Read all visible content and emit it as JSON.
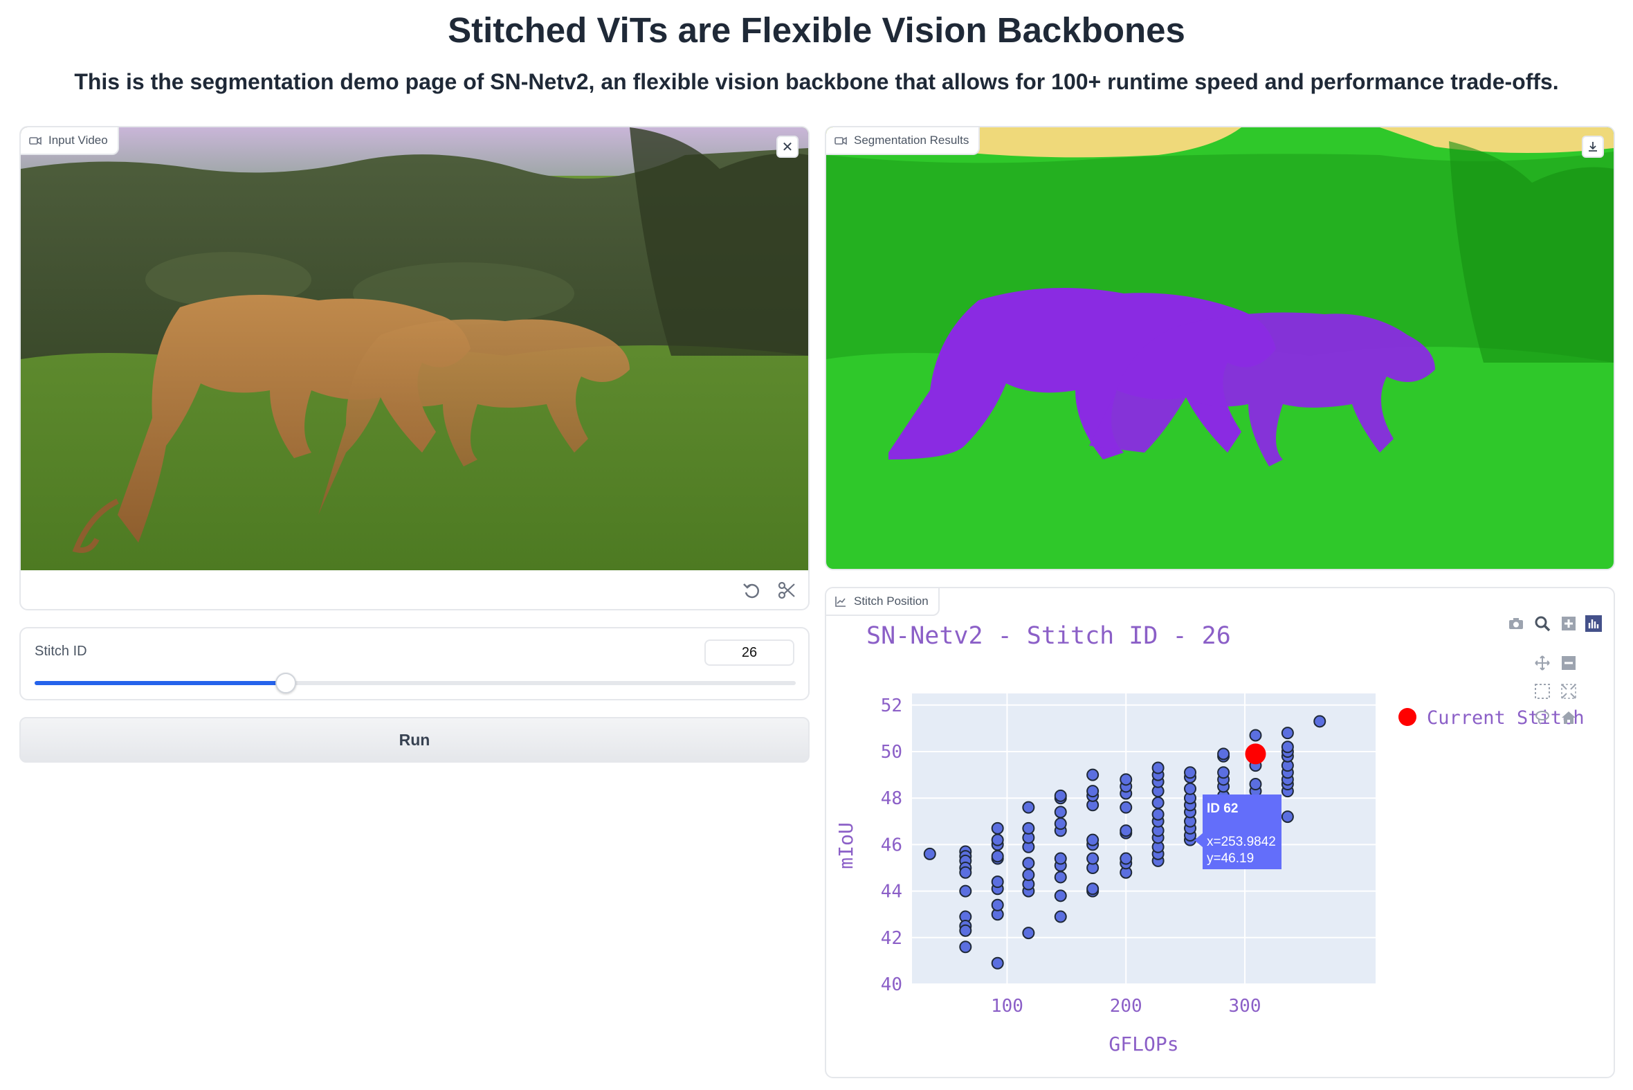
{
  "header": {
    "title": "Stitched ViTs are Flexible Vision Backbones",
    "subtitle": "This is the segmentation demo page of SN-Netv2, an flexible vision backbone that allows for 100+ runtime speed and performance trade-offs."
  },
  "input_video": {
    "label": "Input Video"
  },
  "segmentation": {
    "label": "Segmentation Results"
  },
  "stitch_position": {
    "label": "Stitch Position"
  },
  "slider": {
    "label": "Stitch ID",
    "value": "26",
    "fraction": 0.33
  },
  "run_button": {
    "label": "Run"
  },
  "colors": {
    "accent": "#2563eb",
    "point_fill": "#5b6fe0",
    "current": "#ff0000",
    "plot_bg": "#e5ecf6",
    "plot_text": "#8b5fc7",
    "tooltip": "#636efa",
    "seg_grass": "#2fc82a",
    "seg_animal": "#8a2be2",
    "seg_sky": "#efd97a"
  },
  "chart_data": {
    "type": "scatter",
    "title": "SN-Netv2 - Stitch ID - 26",
    "xlabel": "GFLOPs",
    "ylabel": "mIoU",
    "xlim": [
      20,
      410
    ],
    "ylim": [
      40,
      52.5
    ],
    "xticks": [
      100,
      200,
      300
    ],
    "yticks": [
      40,
      42,
      44,
      46,
      48,
      50,
      52
    ],
    "grid": true,
    "legend": {
      "position": "top-right",
      "entries": [
        "Current Stitch"
      ]
    },
    "series": [
      {
        "name": "",
        "points": [
          [
            35,
            45.6
          ],
          [
            65,
            45.7
          ],
          [
            65,
            45.5
          ],
          [
            65,
            45.3
          ],
          [
            65,
            45.0
          ],
          [
            65,
            44.8
          ],
          [
            65,
            44.0
          ],
          [
            65,
            42.9
          ],
          [
            65,
            42.5
          ],
          [
            65,
            42.3
          ],
          [
            65,
            41.6
          ],
          [
            92,
            40.9
          ],
          [
            92,
            43.0
          ],
          [
            92,
            43.4
          ],
          [
            92,
            44.1
          ],
          [
            92,
            44.4
          ],
          [
            92,
            45.4
          ],
          [
            92,
            45.5
          ],
          [
            92,
            46.0
          ],
          [
            92,
            46.2
          ],
          [
            92,
            46.7
          ],
          [
            118,
            42.2
          ],
          [
            118,
            44.0
          ],
          [
            118,
            44.3
          ],
          [
            118,
            44.7
          ],
          [
            118,
            45.2
          ],
          [
            118,
            45.9
          ],
          [
            118,
            46.3
          ],
          [
            118,
            46.7
          ],
          [
            118,
            47.6
          ],
          [
            145,
            42.9
          ],
          [
            145,
            43.8
          ],
          [
            145,
            44.6
          ],
          [
            145,
            45.1
          ],
          [
            145,
            45.4
          ],
          [
            145,
            46.6
          ],
          [
            145,
            46.9
          ],
          [
            145,
            47.4
          ],
          [
            145,
            48.0
          ],
          [
            145,
            48.1
          ],
          [
            172,
            44.0
          ],
          [
            172,
            44.1
          ],
          [
            172,
            45.0
          ],
          [
            172,
            45.4
          ],
          [
            172,
            46.0
          ],
          [
            172,
            46.2
          ],
          [
            172,
            47.7
          ],
          [
            172,
            48.1
          ],
          [
            172,
            48.3
          ],
          [
            172,
            49.0
          ],
          [
            200,
            44.8
          ],
          [
            200,
            45.2
          ],
          [
            200,
            45.4
          ],
          [
            200,
            46.5
          ],
          [
            200,
            46.6
          ],
          [
            200,
            47.6
          ],
          [
            200,
            48.2
          ],
          [
            200,
            48.5
          ],
          [
            200,
            48.8
          ],
          [
            227,
            45.3
          ],
          [
            227,
            45.6
          ],
          [
            227,
            45.9
          ],
          [
            227,
            46.3
          ],
          [
            227,
            46.6
          ],
          [
            227,
            47.0
          ],
          [
            227,
            47.3
          ],
          [
            227,
            47.8
          ],
          [
            227,
            48.3
          ],
          [
            227,
            48.7
          ],
          [
            227,
            49.0
          ],
          [
            227,
            49.3
          ],
          [
            254,
            46.2
          ],
          [
            254,
            46.4
          ],
          [
            254,
            46.7
          ],
          [
            254,
            47.0
          ],
          [
            254,
            47.4
          ],
          [
            254,
            47.7
          ],
          [
            254,
            48.0
          ],
          [
            254,
            48.4
          ],
          [
            254,
            48.9
          ],
          [
            254,
            49.1
          ],
          [
            282,
            48.1
          ],
          [
            282,
            48.5
          ],
          [
            282,
            48.8
          ],
          [
            282,
            49.1
          ],
          [
            282,
            49.8
          ],
          [
            282,
            49.9
          ],
          [
            309,
            47.9
          ],
          [
            309,
            48.3
          ],
          [
            309,
            48.6
          ],
          [
            309,
            49.4
          ],
          [
            309,
            50.7
          ],
          [
            336,
            47.2
          ],
          [
            336,
            48.3
          ],
          [
            336,
            48.6
          ],
          [
            336,
            48.8
          ],
          [
            336,
            49.1
          ],
          [
            336,
            49.4
          ],
          [
            336,
            49.8
          ],
          [
            336,
            50.0
          ],
          [
            336,
            50.2
          ],
          [
            336,
            50.8
          ],
          [
            363,
            51.3
          ]
        ]
      },
      {
        "name": "Current Stitch",
        "points": [
          [
            309,
            49.9
          ]
        ]
      }
    ],
    "hover": {
      "id": "ID 62",
      "x": "x=253.9842",
      "y": "y=46.19",
      "at": [
        254,
        46.19
      ]
    }
  }
}
